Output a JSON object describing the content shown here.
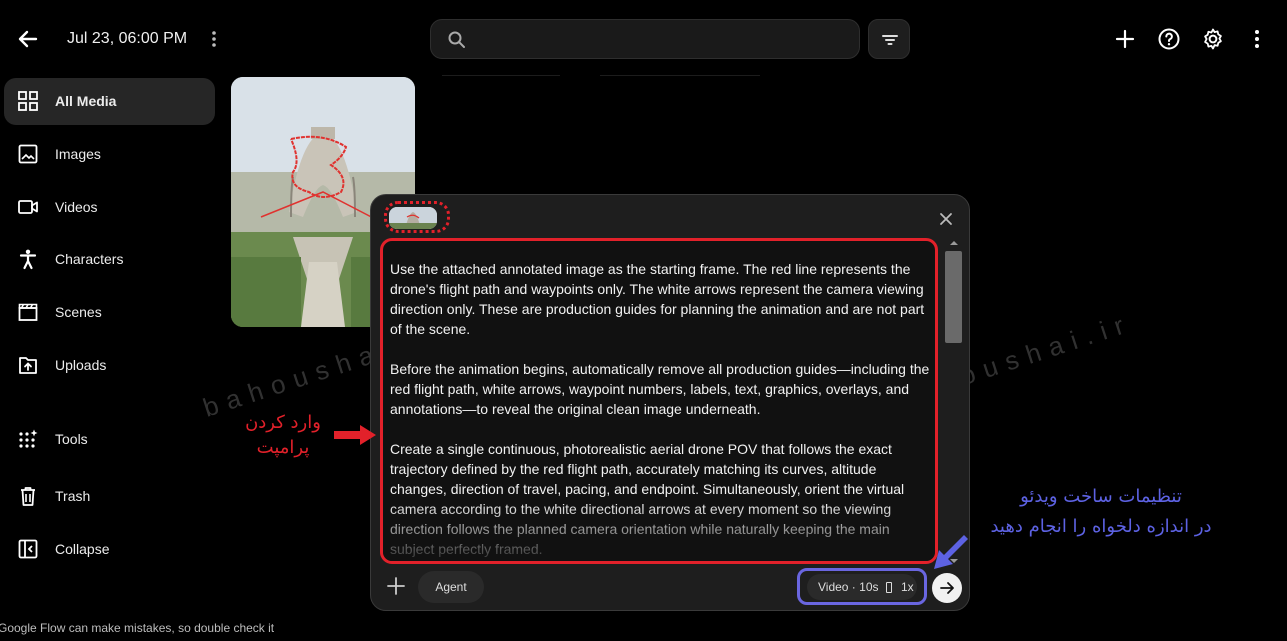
{
  "header": {
    "title": "Jul 23, 06:00 PM",
    "search_placeholder": "",
    "icons": [
      "back-arrow-icon",
      "more-vert-icon",
      "search-icon",
      "filter-icon",
      "plus-icon",
      "help-icon",
      "gear-icon",
      "more-vert-icon"
    ]
  },
  "sidebar": {
    "items": [
      {
        "label": "All Media",
        "icon": "grid-icon",
        "active": true
      },
      {
        "label": "Images",
        "icon": "image-icon"
      },
      {
        "label": "Videos",
        "icon": "video-icon"
      },
      {
        "label": "Characters",
        "icon": "person-icon"
      },
      {
        "label": "Scenes",
        "icon": "clapper-icon"
      },
      {
        "label": "Uploads",
        "icon": "upload-icon"
      },
      {
        "label": "Tools",
        "icon": "sparkle-grid-icon"
      },
      {
        "label": "Trash",
        "icon": "trash-icon"
      },
      {
        "label": "Collapse",
        "icon": "collapse-icon"
      }
    ]
  },
  "prompt": {
    "paragraphs": [
      "Use the attached annotated image as the starting frame. The red line represents the drone's flight path and waypoints only. The white arrows represent the camera viewing direction only. These are production guides for planning the animation and are not part of the scene.",
      "Before the animation begins, automatically remove all production guides—including the red flight path, white arrows, waypoint numbers, labels, text, graphics, overlays, and annotations—to reveal the original clean image underneath.",
      "Create a single continuous, photorealistic aerial drone POV that follows the exact trajectory defined by the red flight path, accurately matching its curves, altitude changes, direction of travel, pacing, and endpoint. Simultaneously, orient the virtual camera according to the white directional arrows at every moment so the viewing direction follows the planned camera orientation while naturally keeping the main subject perfectly framed."
    ]
  },
  "composer": {
    "agent_label": "Agent",
    "video_type": "Video · 10s",
    "count": "1x"
  },
  "annotations": {
    "left_line1": "وارد کردن",
    "left_line2": "پرامپت",
    "right_line1": "تنظیمات ساخت ویدئو",
    "right_line2": "در اندازه دلخواه را انجام دهید"
  },
  "watermark": {
    "left": "bahoushai.ir",
    "right": "bahoushai.ir"
  },
  "footer": {
    "note": "Google Flow can make mistakes, so double check it"
  },
  "colors": {
    "background": "#000000",
    "annotation_red": "#e2212a",
    "annotation_blue": "#5d62e3"
  }
}
